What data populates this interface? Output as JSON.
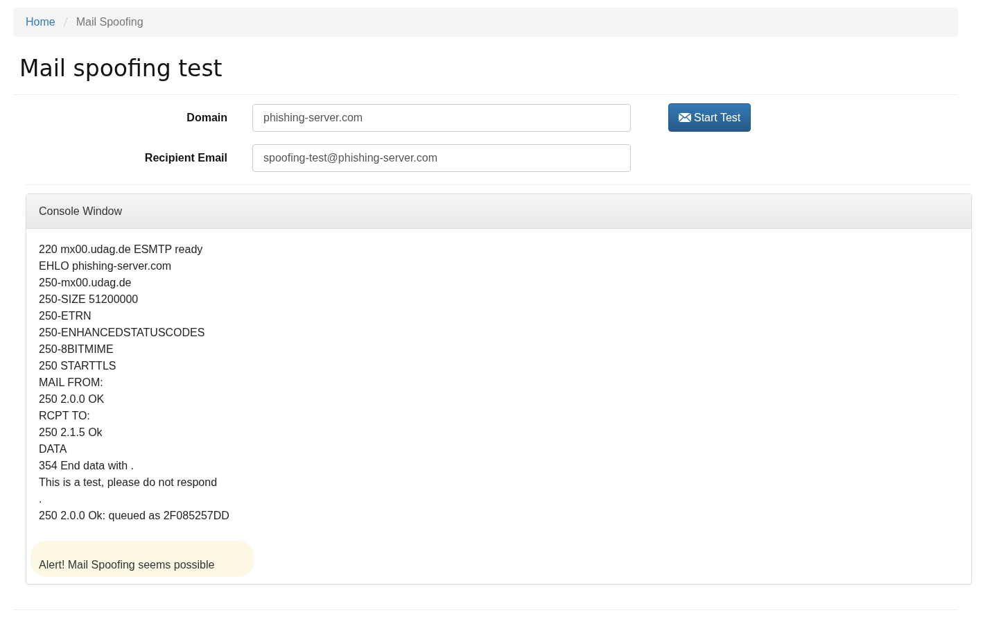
{
  "breadcrumb": [
    {
      "label": "Home",
      "kind": "link"
    },
    {
      "label": "Mail Spoofing",
      "kind": "current"
    }
  ],
  "title": "Mail spoofing test",
  "form": {
    "fields": [
      {
        "label": "Domain",
        "value": "phishing-server.com"
      },
      {
        "label": "Recipient Email",
        "value": "spoofing-test@phishing-server.com"
      }
    ],
    "button": "Start Test"
  },
  "console": {
    "title": "Console Window",
    "lines": [
      "220 mx00.udag.de ESMTP ready",
      "EHLO phishing-server.com",
      "250-mx00.udag.de",
      "250-SIZE 51200000",
      "250-ETRN",
      "250-ENHANCEDSTATUSCODES",
      "250-8BITMIME",
      "250 STARTTLS",
      "MAIL FROM:",
      "250 2.0.0 OK",
      "RCPT TO:",
      "250 2.1.5 Ok",
      "DATA",
      "354 End data with .",
      "This is a test, please do not respond",
      ".",
      "250 2.0.0 Ok: queued as 2F085257DD"
    ],
    "alert": "Alert! Mail Spoofing seems possible"
  }
}
